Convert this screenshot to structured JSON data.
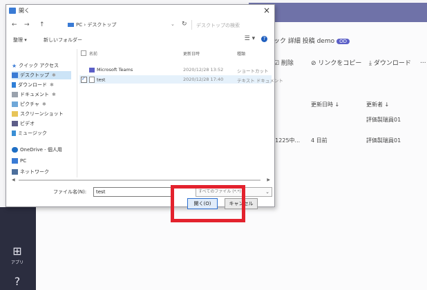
{
  "app": {
    "tabs": {
      "text": "ック 詳細 投稿 demo",
      "badge": "OD"
    },
    "toolbar": {
      "delete": "☑ 削除",
      "copy_link": "⊘ リンクをコピー",
      "download": "⤓ ダウンロード",
      "more": "..."
    },
    "columns": {
      "modified": "更新日時 ↓",
      "modified_by": "更新者 ↓"
    },
    "rows": [
      {
        "name": "",
        "modified": "",
        "modified_by": "評価製瑞員01"
      },
      {
        "name": "_201225中...",
        "modified": "4 日前",
        "modified_by": "評価製瑞員01"
      }
    ],
    "rail": {
      "apps_label": "アプリ",
      "help_glyph": "?"
    }
  },
  "dialog": {
    "title": "開く",
    "close": "×",
    "nav_back": "←",
    "nav_forward": "→",
    "nav_up": "↑",
    "path": "PC › デスクトップ",
    "path_dropdown": "⌄",
    "refresh": "↻",
    "search_placeholder": "デスクトップの検索",
    "commands": {
      "organize": "整理 ▾",
      "new_folder": "新しいフォルダー"
    },
    "view_icons": "☰ ▾",
    "help": "?",
    "nav_items": [
      {
        "label": "クイック アクセス",
        "icon": "star-icon"
      },
      {
        "label": "デスクトップ",
        "icon": "desktop-icon"
      },
      {
        "label": "ダウンロード",
        "icon": "download-icon"
      },
      {
        "label": "ドキュメント",
        "icon": "documents-icon"
      },
      {
        "label": "ピクチャ",
        "icon": "pictures-icon"
      },
      {
        "label": "スクリーンショット",
        "icon": "folder-icon"
      },
      {
        "label": "ビデオ",
        "icon": "videos-icon"
      },
      {
        "label": "ミュージック",
        "icon": "music-icon"
      },
      {
        "label": "OneDrive - 個人用",
        "icon": "cloud-icon"
      },
      {
        "label": "PC",
        "icon": "pc-icon"
      },
      {
        "label": "ネットワーク",
        "icon": "network-icon"
      }
    ],
    "columns": {
      "name": "名前",
      "modified": "更新日時",
      "type": "種類"
    },
    "files": [
      {
        "name": "Microsoft Teams",
        "modified": "2020/12/28 13:52",
        "type": "ショートカット",
        "checked": false
      },
      {
        "name": "test",
        "modified": "2020/12/28 17:40",
        "type": "テキスト ドキュメント",
        "checked": true
      }
    ],
    "filename_label": "ファイル名(N):",
    "filename_value": "test",
    "filetype_value": "すべてのファイル (*.*)",
    "open_button": "開く(O)",
    "cancel_button": "キャンセル"
  },
  "colors": {
    "highlight": "#e3222d",
    "accent": "#3a7bd5",
    "teams_header": "#6f72a8"
  }
}
